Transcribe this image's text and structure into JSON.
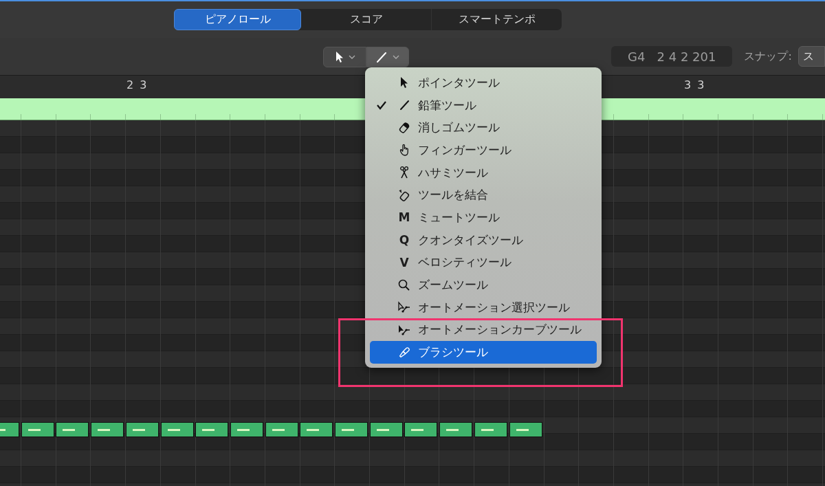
{
  "view_tabs": [
    {
      "label": "ピアノロール",
      "selected": true
    },
    {
      "label": "スコア",
      "selected": false
    },
    {
      "label": "スマートテンポ",
      "selected": false
    }
  ],
  "toolbar": {
    "position": "G4   2 4 2 201",
    "snap_label": "スナップ:",
    "snap_value": "ス"
  },
  "ruler": {
    "markers": [
      "2 3",
      "3 3"
    ]
  },
  "tool_menu": {
    "items": [
      {
        "label": "ポインタツール",
        "kind": "icon",
        "checked": false,
        "selected": false
      },
      {
        "label": "鉛筆ツール",
        "kind": "icon",
        "checked": true,
        "selected": false
      },
      {
        "label": "消しゴムツール",
        "kind": "icon",
        "checked": false,
        "selected": false
      },
      {
        "label": "フィンガーツール",
        "kind": "icon",
        "checked": false,
        "selected": false
      },
      {
        "label": "ハサミツール",
        "kind": "icon",
        "checked": false,
        "selected": false
      },
      {
        "label": "ツールを結合",
        "kind": "icon",
        "checked": false,
        "selected": false
      },
      {
        "label": "ミュートツール",
        "kind": "letter",
        "key": "M",
        "checked": false,
        "selected": false
      },
      {
        "label": "クオンタイズツール",
        "kind": "letter",
        "key": "Q",
        "checked": false,
        "selected": false
      },
      {
        "label": "ベロシティツール",
        "kind": "letter",
        "key": "V",
        "checked": false,
        "selected": false
      },
      {
        "label": "ズームツール",
        "kind": "icon",
        "checked": false,
        "selected": false
      },
      {
        "label": "オートメーション選択ツール",
        "kind": "icon",
        "checked": false,
        "selected": false
      },
      {
        "label": "オートメーションカーブツール",
        "kind": "icon",
        "checked": false,
        "selected": false
      },
      {
        "label": "ブラシツール",
        "kind": "icon",
        "checked": false,
        "selected": true
      }
    ]
  }
}
